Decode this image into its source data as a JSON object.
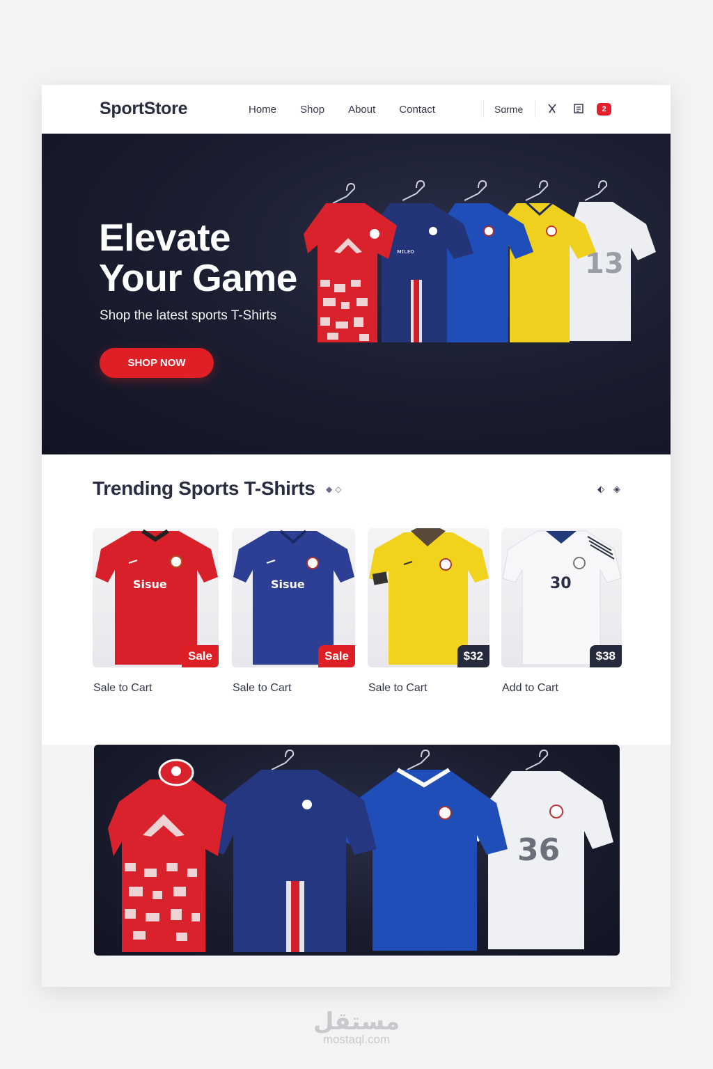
{
  "header": {
    "brand": "SportStore",
    "nav": [
      "Home",
      "Shop",
      "About",
      "Contact"
    ],
    "search_label": "Sɑrme",
    "cart_count": "2"
  },
  "hero": {
    "title_line1": "Elevate",
    "title_line2": "Your Game",
    "subtitle": "Shop the latest sports T-Shirts",
    "cta": "SHOP NOW"
  },
  "trending": {
    "title": "Trending Sports T-Shirts",
    "products": [
      {
        "badge": "Sale",
        "badge_color": "#df1f26",
        "action": "Sale to Cart",
        "shirt_color": "#d8202a",
        "shirt_text": "Sisue"
      },
      {
        "badge": "Sale",
        "badge_color": "#df1f26",
        "action": "Sale to Cart",
        "shirt_color": "#2c3f94",
        "shirt_text": "Sisue"
      },
      {
        "badge": "$32",
        "badge_color": "#262a3d",
        "action": "Sale to Cart",
        "shirt_color": "#f1d21d",
        "shirt_text": ""
      },
      {
        "badge": "$38",
        "badge_color": "#262a3d",
        "action": "Add to Cart",
        "shirt_color": "#f3f3f5",
        "shirt_text": "30"
      }
    ]
  },
  "banner": {
    "shirt_number": "36"
  },
  "watermark": {
    "arabic": "مستقل",
    "latin": "mostaql.com"
  },
  "colors": {
    "accent": "#df1f26",
    "dark": "#1b1e30",
    "navy": "#2c3f94",
    "royal": "#1f4eb8",
    "yellow": "#f1d21d"
  }
}
